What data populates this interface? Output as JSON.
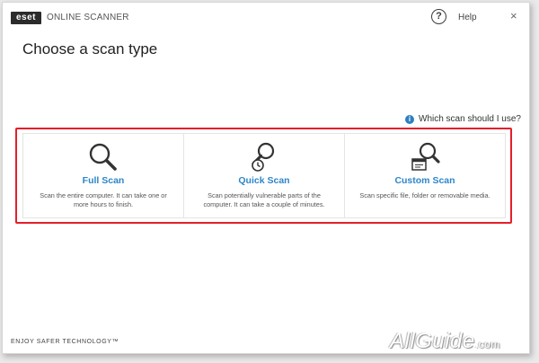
{
  "titlebar": {
    "logo_text": "eset",
    "product_name": "ONLINE SCANNER",
    "help_label": "Help",
    "close_glyph": "×"
  },
  "main": {
    "title": "Choose a scan type",
    "which_scan_link": "Which scan should I use?",
    "cards": [
      {
        "title": "Full Scan",
        "description": "Scan the entire computer. It can take one or more hours to finish.",
        "icon": "magnifier-icon"
      },
      {
        "title": "Quick Scan",
        "description": "Scan potentially vulnerable parts of the computer. It can take a couple of minutes.",
        "icon": "magnifier-clock-icon"
      },
      {
        "title": "Custom Scan",
        "description": "Scan specific file, folder or removable media.",
        "icon": "magnifier-window-icon"
      }
    ]
  },
  "footer": {
    "tagline": "ENJOY SAFER TECHNOLOGY™"
  },
  "watermark": {
    "text": "AllGuide",
    "tld": ".com"
  },
  "colors": {
    "accent_blue": "#2d86c8",
    "highlight_red": "#e41f2a",
    "text_dark": "#222222"
  }
}
